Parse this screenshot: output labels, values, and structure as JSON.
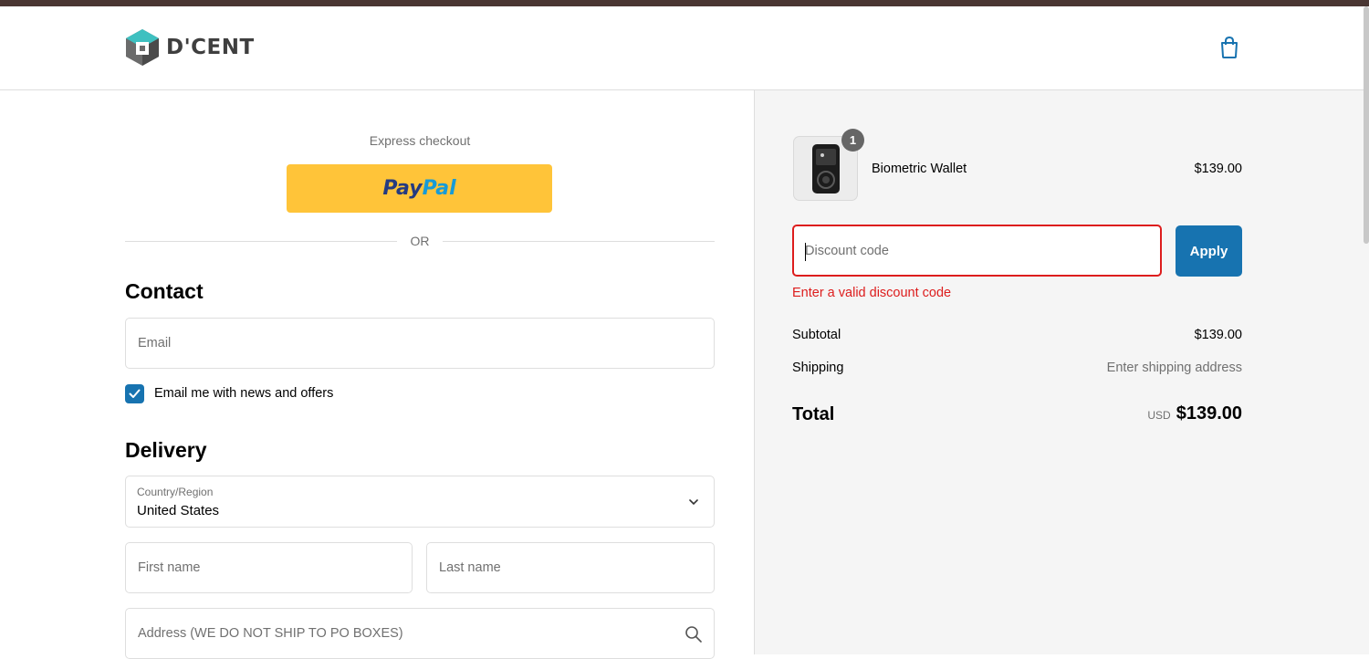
{
  "brand": {
    "name": "D'CENT",
    "accent": "#1773b0",
    "error": "#dd1d1d"
  },
  "header": {
    "cart_icon": "shopping-bag-icon"
  },
  "express": {
    "label": "Express checkout",
    "paypal_part1": "Pay",
    "paypal_part2": "Pal",
    "or_text": "OR"
  },
  "contact": {
    "title": "Contact",
    "email_placeholder": "Email",
    "newsletter_label": "Email me with news and offers",
    "newsletter_checked": true
  },
  "delivery": {
    "title": "Delivery",
    "country_label": "Country/Region",
    "country_value": "United States",
    "first_name_placeholder": "First name",
    "last_name_placeholder": "Last name",
    "address_placeholder": "Address (WE DO NOT SHIP TO PO BOXES)"
  },
  "order": {
    "item": {
      "name": "Biometric Wallet",
      "price": "$139.00",
      "quantity": "1"
    },
    "discount_placeholder": "Discount code",
    "apply_label": "Apply",
    "discount_error": "Enter a valid discount code",
    "subtotal_label": "Subtotal",
    "subtotal_value": "$139.00",
    "shipping_label": "Shipping",
    "shipping_value": "Enter shipping address",
    "total_label": "Total",
    "total_currency": "USD",
    "total_value": "$139.00"
  }
}
